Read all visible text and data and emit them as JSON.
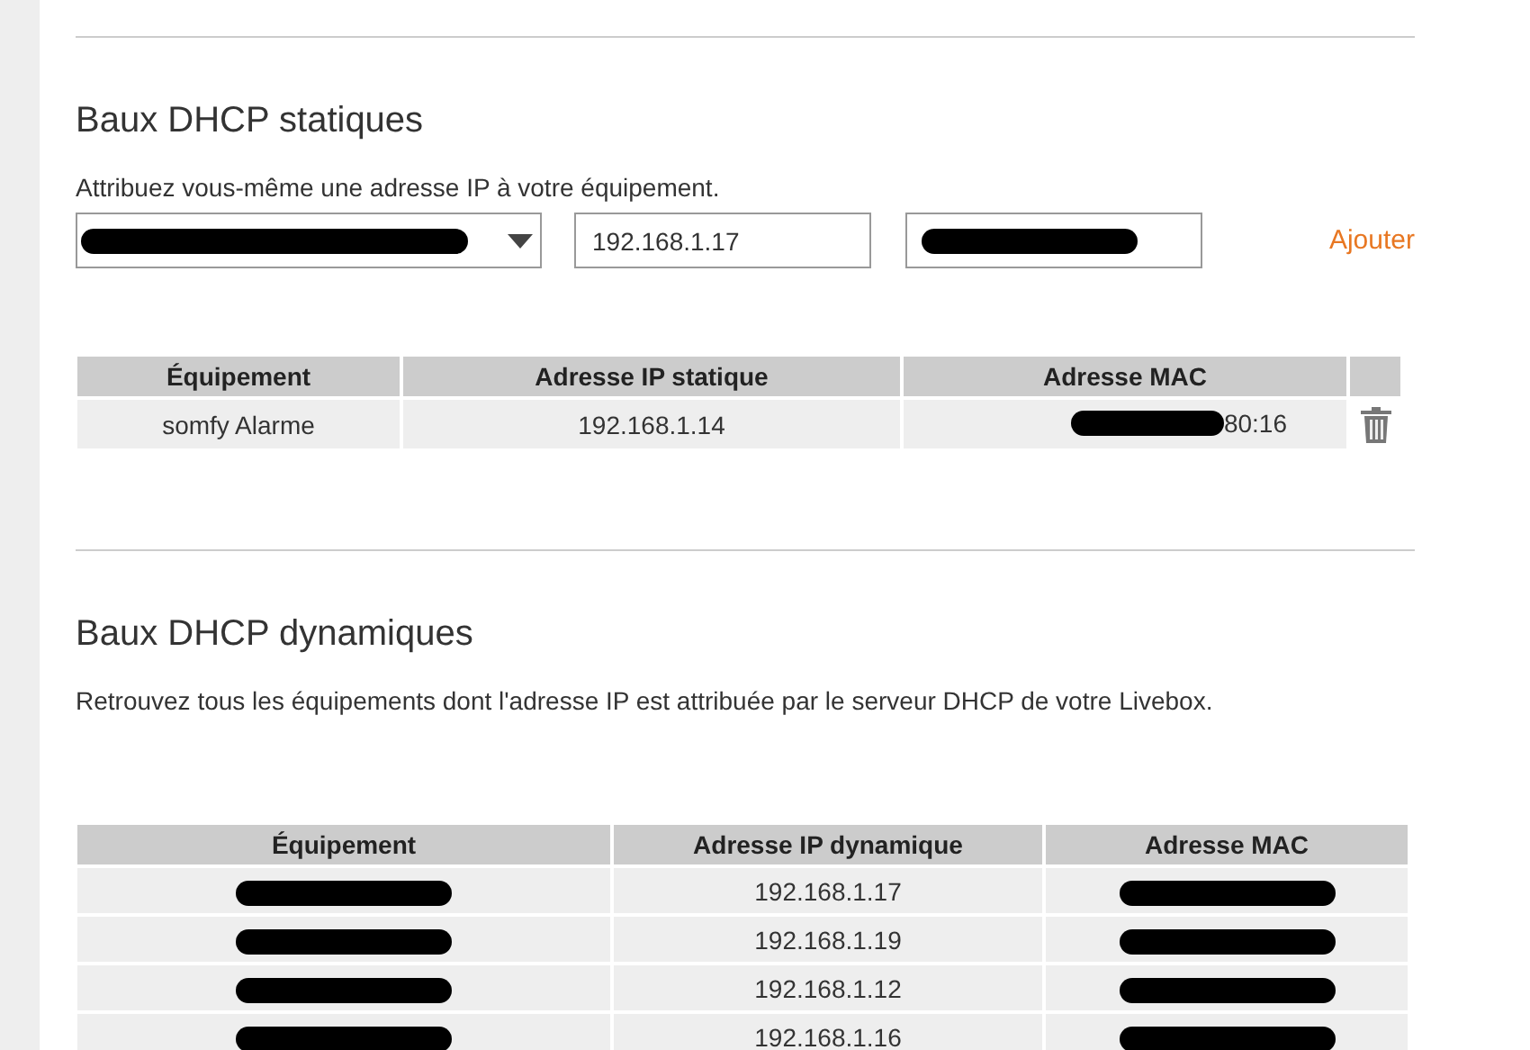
{
  "static_section": {
    "title": "Baux DHCP statiques",
    "description": "Attribuez vous-même une adresse IP à votre équipement.",
    "form": {
      "device_select": {
        "redacted": true
      },
      "ip_field": {
        "value": "192.168.1.17"
      },
      "mac_field": {
        "redacted": true
      },
      "add_link": "Ajouter"
    },
    "table": {
      "columns": [
        "Équipement",
        "Adresse IP statique",
        "Adresse MAC"
      ],
      "rows": [
        {
          "device": "somfy Alarme",
          "ip": "192.168.1.14",
          "mac": "80:16",
          "mac_redacted": true
        }
      ]
    }
  },
  "dynamic_section": {
    "title": "Baux DHCP dynamiques",
    "description": "Retrouvez tous les équipements dont l'adresse IP est attribuée par le serveur DHCP de votre Livebox.",
    "table": {
      "columns": [
        "Équipement",
        "Adresse IP dynamique",
        "Adresse MAC"
      ],
      "rows": [
        {
          "device_redacted": true,
          "ip": "192.168.1.17",
          "mac_redacted": true
        },
        {
          "device_redacted": true,
          "ip": "192.168.1.19",
          "mac_redacted": true
        },
        {
          "device_redacted": true,
          "ip": "192.168.1.12",
          "mac_redacted": true
        },
        {
          "device_redacted": true,
          "ip": "192.168.1.16",
          "mac_redacted": true
        }
      ]
    }
  }
}
